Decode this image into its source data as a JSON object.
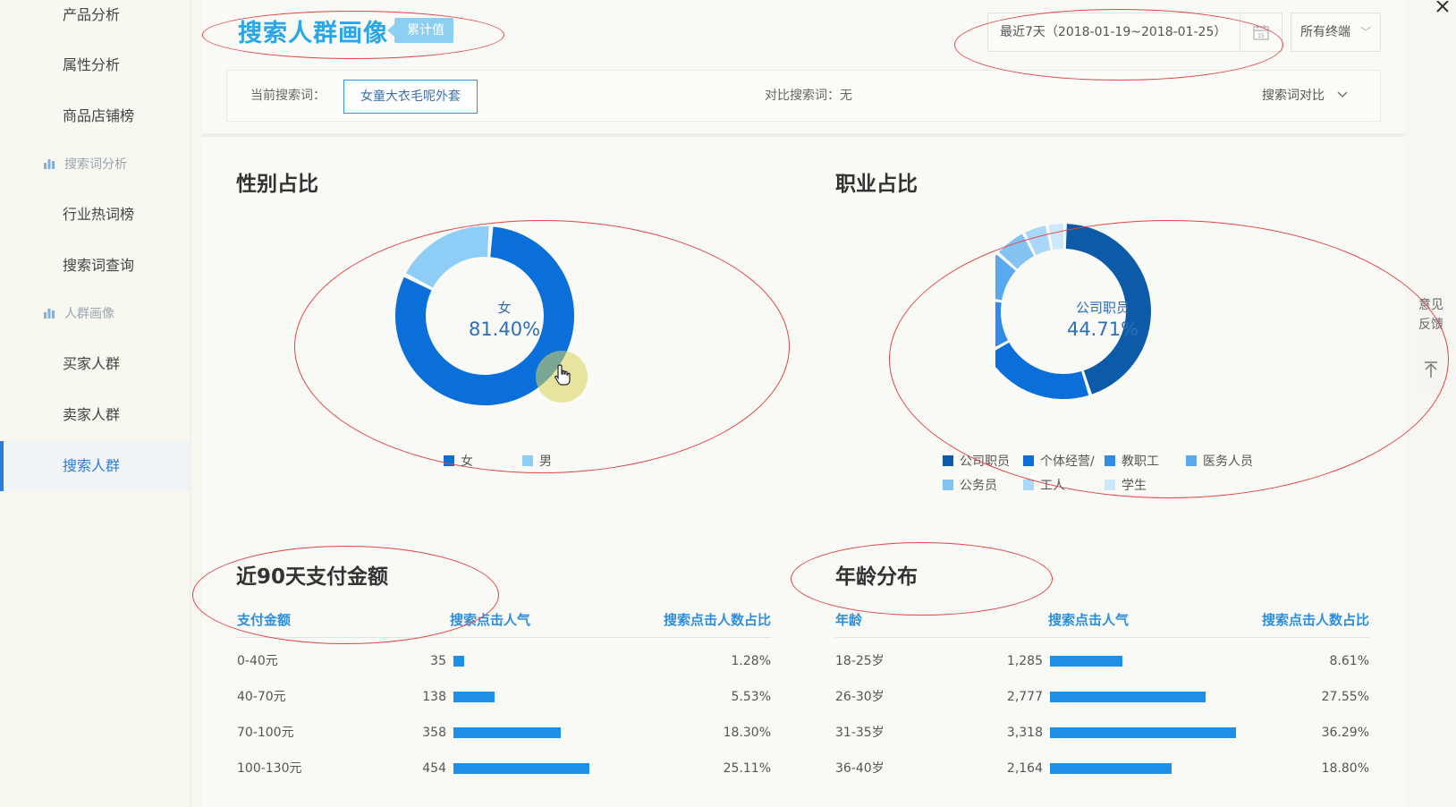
{
  "sidebar": {
    "items": [
      {
        "label": "产品分析"
      },
      {
        "label": "属性分析"
      },
      {
        "label": "商品店铺榜"
      },
      {
        "label": "行业热词榜"
      },
      {
        "label": "搜索词查询"
      },
      {
        "label": "买家人群"
      },
      {
        "label": "卖家人群"
      },
      {
        "label": "搜索人群"
      }
    ],
    "sections": [
      {
        "label": "搜索词分析",
        "icon": "bar-chart-icon"
      },
      {
        "label": "人群画像",
        "icon": "bar-chart-icon"
      }
    ],
    "active_label": "搜索人群"
  },
  "header": {
    "title": "搜索人群画像",
    "tag": "累计值",
    "date_range": "最近7天（2018-01-19~2018-01-25）",
    "calendar_day": "15",
    "terminal": "所有终端"
  },
  "search_bar": {
    "current_label": "当前搜索词：",
    "current_value": "女童大衣毛呢外套",
    "compare_text": "对比搜索词：无",
    "compare_toggle": "搜索词对比"
  },
  "gender": {
    "title": "性别占比",
    "center_label": "女",
    "center_value": "81.40%",
    "legend": [
      {
        "label": "女",
        "color": "#0a6fd8"
      },
      {
        "label": "男",
        "color": "#8ecdf5"
      }
    ]
  },
  "occupation": {
    "title": "职业占比",
    "center_label": "公司职员",
    "center_value": "44.71%",
    "legend": [
      {
        "label": "公司职员",
        "color": "#0d5aa8"
      },
      {
        "label": "个体经营/",
        "color": "#0a6fd8"
      },
      {
        "label": "教职工",
        "color": "#2f8be6"
      },
      {
        "label": "医务人员",
        "color": "#5aa8ee"
      },
      {
        "label": "公务员",
        "color": "#84c2f2"
      },
      {
        "label": "工人",
        "color": "#a9d7f7"
      },
      {
        "label": "学生",
        "color": "#cde7fb"
      }
    ]
  },
  "chart_data": [
    {
      "type": "pie",
      "title": "性别占比",
      "categories": [
        "女",
        "男"
      ],
      "values": [
        81.4,
        18.6
      ]
    },
    {
      "type": "pie",
      "title": "职业占比",
      "categories": [
        "公司职员",
        "个体经营/",
        "教职工",
        "医务人员",
        "公务员",
        "工人",
        "学生"
      ],
      "values": [
        44.71,
        22.0,
        10.5,
        9.0,
        6.0,
        4.5,
        3.29
      ]
    },
    {
      "type": "table",
      "title": "近90天支付金额",
      "columns": [
        "支付金额",
        "搜索点击人气",
        "搜索点击人数占比"
      ],
      "rows": [
        [
          "0-40元",
          35,
          "1.28%"
        ],
        [
          "40-70元",
          138,
          "5.53%"
        ],
        [
          "70-100元",
          358,
          "18.30%"
        ],
        [
          "100-130元",
          454,
          "25.11%"
        ]
      ]
    },
    {
      "type": "table",
      "title": "年龄分布",
      "columns": [
        "年龄",
        "搜索点击人气",
        "搜索点击人数占比"
      ],
      "rows": [
        [
          "18-25岁",
          "1,285",
          "8.61%"
        ],
        [
          "26-30岁",
          "2,777",
          "27.55%"
        ],
        [
          "31-35岁",
          "3,318",
          "36.29%"
        ],
        [
          "36-40岁",
          "2,164",
          "18.80%"
        ]
      ]
    }
  ],
  "pay_table": {
    "title": "近90天支付金额",
    "headers": [
      "支付金额",
      "搜索点击人气",
      "搜索点击人数占比"
    ],
    "rows": [
      {
        "range": "0-40元",
        "pop": "35",
        "popv": 35,
        "pct": "1.28%"
      },
      {
        "range": "40-70元",
        "pop": "138",
        "popv": 138,
        "pct": "5.53%"
      },
      {
        "range": "70-100元",
        "pop": "358",
        "popv": 358,
        "pct": "18.30%"
      },
      {
        "range": "100-130元",
        "pop": "454",
        "popv": 454,
        "pct": "25.11%"
      }
    ]
  },
  "age_table": {
    "title": "年龄分布",
    "headers": [
      "年龄",
      "搜索点击人气",
      "搜索点击人数占比"
    ],
    "rows": [
      {
        "range": "18-25岁",
        "pop": "1,285",
        "popv": 1285,
        "pct": "8.61%"
      },
      {
        "range": "26-30岁",
        "pop": "2,777",
        "popv": 2777,
        "pct": "27.55%"
      },
      {
        "range": "31-35岁",
        "pop": "3,318",
        "popv": 3318,
        "pct": "36.29%"
      },
      {
        "range": "36-40岁",
        "pop": "2,164",
        "popv": 2164,
        "pct": "18.80%"
      }
    ]
  },
  "side_widgets": {
    "feedback": "意见反馈",
    "to_top_icon": "arrow-up-icon",
    "close_icon": "close-icon"
  },
  "colors": {
    "accent": "#2aa6e6",
    "bar": "#1f8ee6",
    "annotation": "#e04545"
  }
}
